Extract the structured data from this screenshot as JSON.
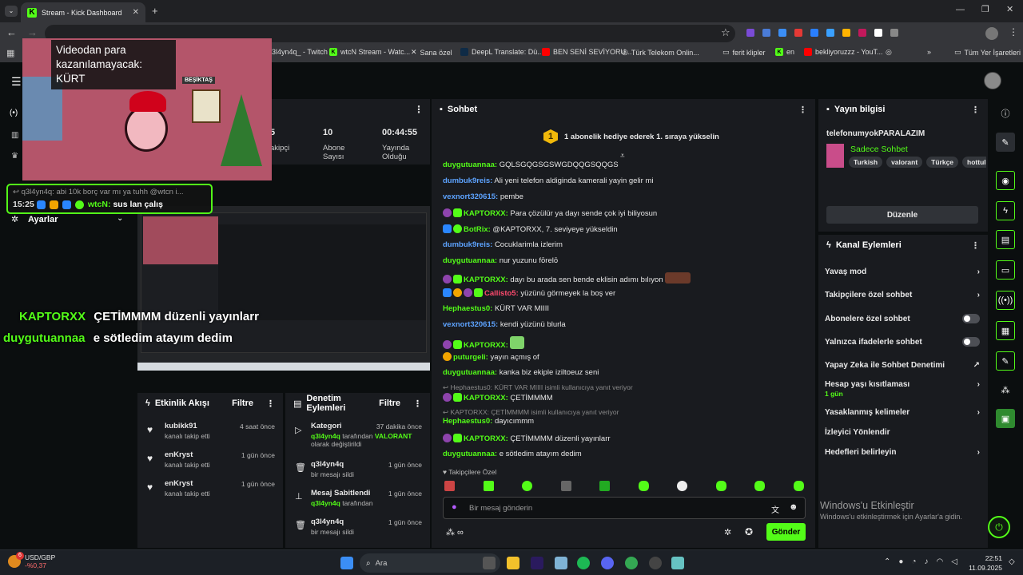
{
  "browser": {
    "tab_title": "Stream - Kick Dashboard",
    "bookmarks": [
      "3l4yn4q_ - Twitch",
      "wtcN Stream - Watc...",
      "Sana özel",
      "DeepL Translate: Dü...",
      "BEN SENİ SEVİYORU...",
      "Türk Telekom Onlin...",
      "ferit klipler",
      "en",
      "bekliyoruzzz - YouT...",
      "Tüm Yer İşaretleri"
    ]
  },
  "overlay": {
    "notice_line1": "Videodan para",
    "notice_line2": "kazanılamayacak: KÜRT",
    "reply_preview": "q3l4yn4q: abi 10k borç var mı ya tuhh @wtcn i...",
    "time": "15:25",
    "chat_user": "wtcN:",
    "chat_text": "sus lan çalış",
    "cam_sign": "BEŞİKTAŞ",
    "banner_user1": "KAPTORXX",
    "banner_text1": "ÇETİMMMM düzenli yayınlarr",
    "banner_user2": "duygutuannaa",
    "banner_text2": "e sötledim atayım dedim"
  },
  "stats": [
    {
      "value": "5",
      "label": "akipçi"
    },
    {
      "value": "10",
      "label": "Abone Sayısı"
    },
    {
      "value": "00:44:55",
      "label": "Yayında Olduğu"
    }
  ],
  "left_menu": {
    "settings_label": "Ayarlar"
  },
  "activity": {
    "title": "Etkinlik Akışı",
    "filter": "Filtre",
    "items": [
      {
        "user": "kubikk91",
        "action": "kanalı takip etti",
        "time": "4 saat önce"
      },
      {
        "user": "enKryst",
        "action": "kanalı takip etti",
        "time": "1 gün önce"
      },
      {
        "user": "enKryst",
        "action": "kanalı takip etti",
        "time": "1 gün önce"
      }
    ]
  },
  "moderation": {
    "title": "Denetim Eylemleri",
    "filter": "Filtre",
    "items": [
      {
        "title": "Kategori",
        "user": "q3l4yn4q",
        "mid": "tarafından",
        "highlight": "VALORANT",
        "tail": "olarak değiştirildi",
        "time": "37 dakika önce"
      },
      {
        "title": "q3l4yn4q",
        "user": "",
        "mid": "bir mesajı sildi",
        "highlight": "",
        "tail": "",
        "time": "1 gün önce"
      },
      {
        "title": "Mesaj Sabitlendi",
        "user": "q3l4yn4q",
        "mid": "tarafından",
        "highlight": "",
        "tail": "",
        "time": "1 gün önce"
      },
      {
        "title": "q3l4yn4q",
        "user": "",
        "mid": "bir mesajı sildi",
        "highlight": "",
        "tail": "",
        "time": "1 gün önce"
      }
    ]
  },
  "chat": {
    "title": "Sohbet",
    "pinned": "1 abonelik hediye ederek 1. sıraya yükselin",
    "pinned_number": "1",
    "messages": [
      {
        "user": "duygutuannaa:",
        "text": "GQLSGQGSGSWGDQQGSQQGS",
        "color": "green"
      },
      {
        "user": "dumbuk9reis:",
        "text": "Ali yeni telefon aldiginda kamerali yayin gelir mi",
        "color": "blue"
      },
      {
        "user": "vexnort320615:",
        "text": "pembe",
        "color": "blue"
      },
      {
        "user": "KAPTORXX:",
        "text": "Para çözülür ya dayı sende çok iyi biliyosun",
        "color": "green"
      },
      {
        "user": "BotRix:",
        "text": "@KAPTORXX, 7. seviyeye yükseldin",
        "color": "green"
      },
      {
        "user": "dumbuk9reis:",
        "text": "Cocuklarimla izlerim",
        "color": "blue"
      },
      {
        "user": "duygutuannaa:",
        "text": "nur yuzunu fōrelō",
        "color": "green"
      },
      {
        "user": "KAPTORXX:",
        "text": "dayı bu arada sen bende eklisin adımı bılıyon",
        "color": "green"
      },
      {
        "user": "Callisto5:",
        "text": "yüzünü görmeyek la boş ver",
        "color": "red"
      },
      {
        "user": "Hephaestus0:",
        "text": "KÜRT VAR MIIII",
        "color": "green"
      },
      {
        "user": "vexnort320615:",
        "text": "kendi yüzünü blurla",
        "color": "blue"
      },
      {
        "user": "KAPTORXX:",
        "text": "",
        "color": "green"
      },
      {
        "user": "puturgeli:",
        "text": "yayın açmış of",
        "color": "green"
      },
      {
        "user": "duygutuannaa:",
        "text": "kanka biz ekiple iziltoeuz seni",
        "color": "green"
      },
      {
        "user": "KAPTORXX:",
        "text": "ÇETİMMMM",
        "color": "green"
      },
      {
        "user": "Hephaestus0:",
        "text": "dayıcımmm",
        "color": "green"
      },
      {
        "user": "KAPTORXX:",
        "text": "ÇETİMMMM düzenli yayınlarr",
        "color": "green"
      },
      {
        "user": "duygutuannaa:",
        "text": "e sötledim atayım dedim",
        "color": "green"
      }
    ],
    "reply1": "Hephaestus0: KÜRT VAR MIIII isimli kullanıcıya yanıt veriyor",
    "reply2": "KAPTORXX: ÇETİMMMM isimli kullanıcıya yanıt veriyor",
    "followers_only": "Takipçilere Özel",
    "input_placeholder": "Bir mesaj gönderin",
    "send_label": "Gönder"
  },
  "stream_info": {
    "title": "Yayın bilgisi",
    "stream_title": "telefonumyokPARALAZIM",
    "category": "Sadece Sohbet",
    "tags": [
      "Turkish",
      "valorant",
      "Türkçe",
      "hottul"
    ],
    "edit_label": "Düzenle"
  },
  "channel_actions": {
    "title": "Kanal Eylemleri",
    "items": [
      {
        "label": "Yavaş mod",
        "control": "chevron",
        "sub": ""
      },
      {
        "label": "Takipçilere özel sohbet",
        "control": "chevron",
        "sub": ""
      },
      {
        "label": "Abonelere özel sohbet",
        "control": "toggle",
        "sub": ""
      },
      {
        "label": "Yalnızca ifadelerle sohbet",
        "control": "toggle",
        "sub": ""
      },
      {
        "label": "Yapay Zeka ile Sohbet Denetimi",
        "control": "external",
        "sub": ""
      },
      {
        "label": "Hesap yaşı kısıtlaması",
        "control": "chevron",
        "sub": "1 gün"
      },
      {
        "label": "Yasaklanmış kelimeler",
        "control": "chevron",
        "sub": ""
      },
      {
        "label": "İzleyici Yönlendir",
        "control": "none",
        "sub": ""
      },
      {
        "label": "Hedefleri belirleyin",
        "control": "chevron",
        "sub": ""
      }
    ]
  },
  "windows": {
    "activate_title": "Windows'u Etkinleştir",
    "activate_sub": "Windows'u etkinleştirmek için Ayarlar'a gidin.",
    "ticker_name": "USD/GBP",
    "ticker_change": "-%0,37",
    "ticker_badge": "6",
    "search": "Ara",
    "time": "22:51",
    "date": "11.09.2025"
  },
  "colors": {
    "kick_green": "#53fc18",
    "panel": "#191b1f",
    "bg": "#0b0e0f"
  }
}
